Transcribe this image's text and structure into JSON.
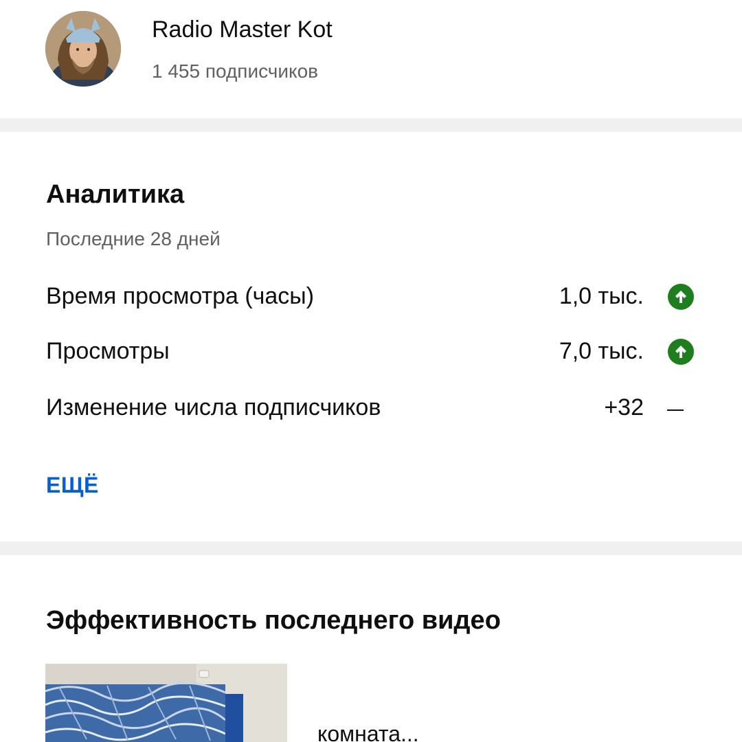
{
  "channel": {
    "name": "Radio Master Kot",
    "subscribers": "1 455 подписчиков"
  },
  "analytics": {
    "title": "Аналитика",
    "period": "Последние 28 дней",
    "metrics": [
      {
        "label": "Время просмотра (часы)",
        "value": "1,0 тыс.",
        "trend": "up"
      },
      {
        "label": "Просмотры",
        "value": "7,0 тыс.",
        "trend": "up"
      },
      {
        "label": "Изменение числа подписчиков",
        "value": "+32",
        "trend": "none"
      }
    ],
    "more_label": "ЕЩЁ"
  },
  "latest_video": {
    "title": "Эффективность последнего видео",
    "video_title": "комната..."
  },
  "colors": {
    "accent": "#065fd4",
    "trend_up": "#1e7e1e",
    "divider": "#f0f0f0",
    "secondary_text": "#606060"
  }
}
